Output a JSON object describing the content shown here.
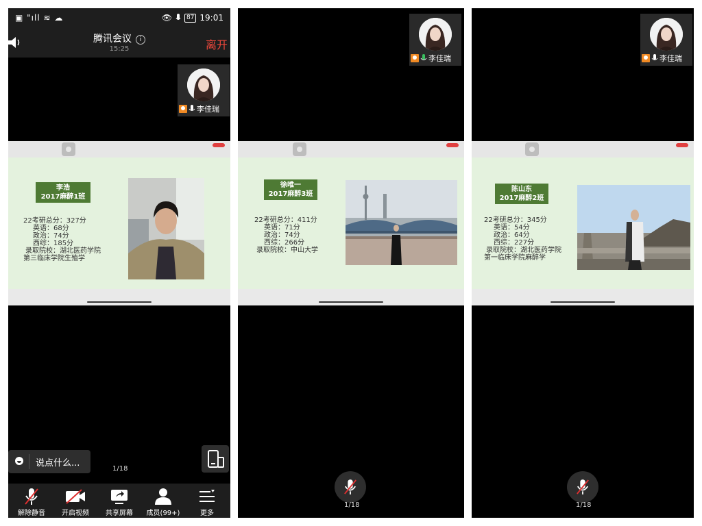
{
  "status": {
    "left": "▣ \"ıll ≋ ☁",
    "battery": "87",
    "time": "19:01"
  },
  "header": {
    "title": "腾讯会议",
    "info_glyph": "i",
    "time": "15:25",
    "leave_label": "离开"
  },
  "self_tile": {
    "name": "李佳瑞"
  },
  "slides": [
    {
      "name": "李浩",
      "class": "2017麻醉1班",
      "lines": [
        "22考研总分：327分",
        "英语：68分",
        "政治：74分",
        "西综：185分",
        "录取院校：湖北医药学院",
        "第三临床学院生殖学"
      ]
    },
    {
      "name": "徐唯一",
      "class": "2017麻醉3班",
      "lines": [
        "22考研总分：411分",
        "英语：71分",
        "政治：74分",
        "西综：266分",
        "录取院校：中山大学"
      ]
    },
    {
      "name": "陈山东",
      "class": "2017麻醉2班",
      "lines": [
        "22考研总分：345分",
        "英语：54分",
        "政治：64分",
        "西综：227分",
        "录取院校：湖北医药学院",
        "第一临床学院麻醉学"
      ]
    }
  ],
  "chat_placeholder": "说点什么...",
  "page_indicator": "1/18",
  "toolbar": [
    {
      "label": "解除静音",
      "icon": "mic-muted-icon"
    },
    {
      "label": "开启视频",
      "icon": "video-off-icon"
    },
    {
      "label": "共享屏幕",
      "icon": "share-screen-icon"
    },
    {
      "label": "成员(99+)",
      "icon": "members-icon"
    },
    {
      "label": "更多",
      "icon": "more-icon"
    }
  ],
  "colors": {
    "leave": "#f0483c",
    "slide_bg": "#e4f2de",
    "name_box": "#4e7a34",
    "host_badge": "#f08a24"
  }
}
